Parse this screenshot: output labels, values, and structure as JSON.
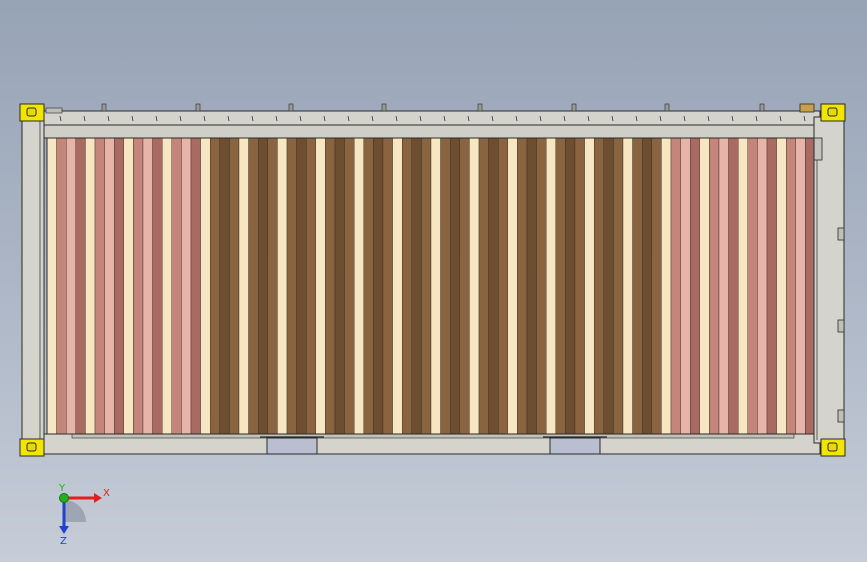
{
  "app": {
    "view": "cad-3d-viewport",
    "background_colors": [
      "#97a3b6",
      "#c6cdd8"
    ]
  },
  "model": {
    "name": "container-side-panel",
    "colors": {
      "frame": "#d4d4cc",
      "frame_dark": "#b8b8b0",
      "outline": "#2a2a2a",
      "corner_casting": "#f2e600",
      "fork_pocket": "#b9bfd0",
      "rose": "#c4857a",
      "rose_dark": "#a86a62",
      "brown": "#8a6440",
      "brown_dark": "#6e4e30",
      "cream": "#f6e6c2",
      "pale_pink": "#e6b4a8"
    },
    "corner_count": 4,
    "fork_pocket_count": 2
  },
  "triad": {
    "x_label": "X",
    "y_label": "Y",
    "z_label": "Z",
    "x_color": "#e02020",
    "y_color": "#20b020",
    "z_color": "#2040d0"
  }
}
